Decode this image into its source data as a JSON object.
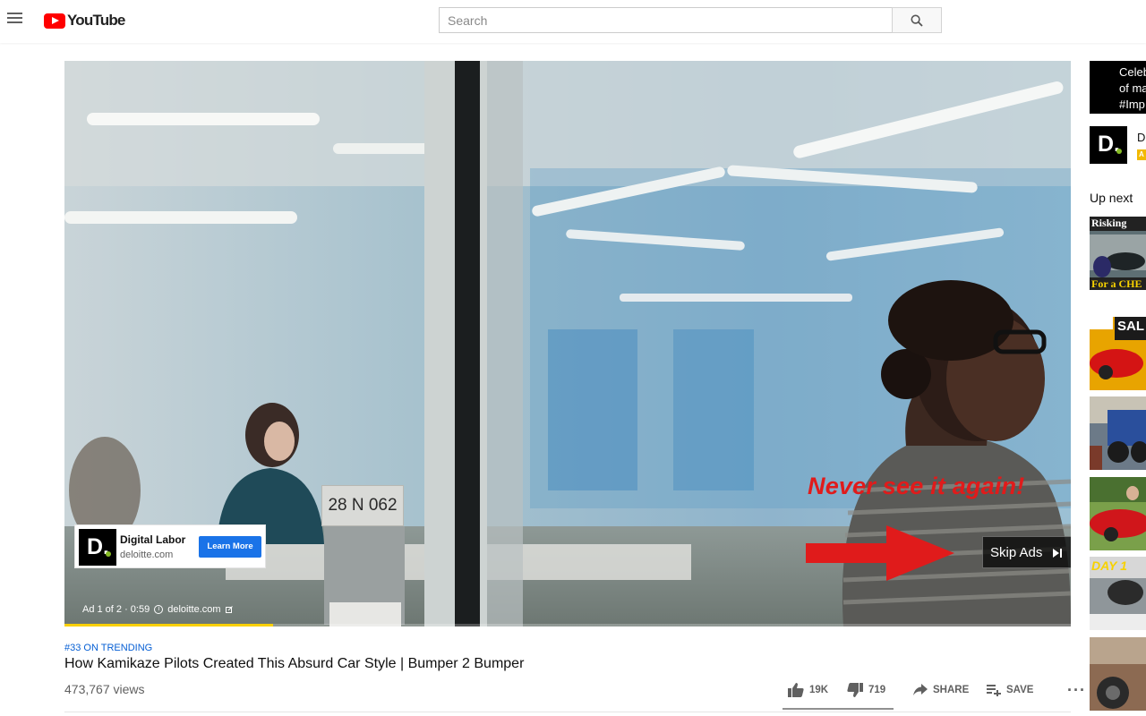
{
  "header": {
    "menu_icon": "hamburger-menu-icon",
    "logo_text": "YouTube",
    "search_placeholder": "Search",
    "search_icon": "search-icon"
  },
  "player": {
    "room_sign": "28 N 062",
    "ad_card": {
      "logo_letter": "D.",
      "title": "Digital Labor",
      "url": "deloitte.com",
      "cta": "Learn More"
    },
    "ad_info": {
      "counter": "Ad 1 of 2 · 0:59",
      "info_icon": "i",
      "link": "deloitte.com"
    },
    "overlay_text": "Never see it again!",
    "skip_button": "Skip Ads",
    "progress_fraction": 0.207,
    "colors": {
      "progress": "#f9d000",
      "overlay_text": "#e01b1b",
      "cta": "#1a73e8",
      "brand_dot": "#86bc25"
    }
  },
  "video": {
    "trending": "#33 ON TRENDING",
    "title": "How Kamikaze Pilots Created This Absurd Car Style | Bumper 2 Bumper",
    "views": "473,767 views"
  },
  "actions": {
    "likes": "19K",
    "dislikes": "719",
    "share": "SHARE",
    "save": "SAVE",
    "more": "···"
  },
  "sidebar": {
    "ad_media_text": "Celeb\nof ma\n#Imp",
    "ad_logo_letter": "D.",
    "ad_name": "D",
    "ad_badge": "A",
    "up_next": "Up next",
    "thumbnails": [
      {
        "caption_top": "Risking",
        "caption_bottom": "For a CHE"
      },
      {
        "caption_top": "SAL"
      },
      {
        "caption_top": ""
      },
      {
        "caption_top": ""
      },
      {
        "caption_top": "DAY 1"
      },
      {
        "caption_top": ""
      }
    ]
  }
}
